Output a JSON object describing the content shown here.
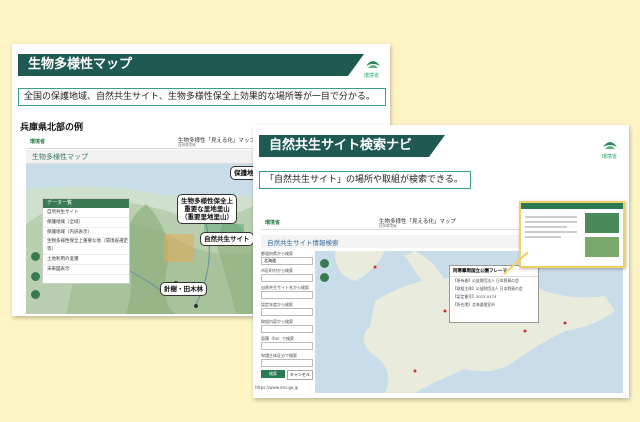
{
  "card1": {
    "title": "生物多様性マップ",
    "logo_text": "環境省",
    "description": "全国の保護地域、自然共生サイト、生物多様性保全上効果的な場所等が一目で分かる。",
    "example_label": "兵庫県北部の例",
    "site_header_title": "生物多様性「見える化」マップ",
    "site_header_sub": "自然環境局",
    "logo_small": "環境省",
    "map_title": "生物多様性マップ",
    "layer_panel_title": "データ一覧",
    "layers": [
      "自然共生サイト",
      "保護地域（全域）",
      "保護地域（内訳表示）",
      "生物多様性保全上重要な地（環境省選定等）",
      "土地利用の変遷",
      "未来図表示"
    ],
    "callouts": {
      "protected": "保護地域",
      "important": "生物多様性保全上\n重要な里地里山\n（重要里地里山）",
      "oecm": "自然共生サイト",
      "forest": "針樹・田木林"
    }
  },
  "card2": {
    "title": "自然共生サイト検索ナビ",
    "logo_text": "環境省",
    "description": "「自然共生サイト」の場所や取組が検索できる。",
    "site_header_title": "生物多様性「見える化」マップ",
    "site_header_sub": "自然環境局",
    "logo_small": "環境省",
    "page_title": "自然共生サイト情報検索",
    "search_labels": [
      "都道府県から検索",
      "市区町村から検索",
      "自然共生サイト名から検索",
      "認定年度から検索",
      "取組内容から検索",
      "面積（ha）で検索",
      "申請主体区分で検索"
    ],
    "search_placeholder": "北海道",
    "popup_title": "阿寒摩周国立公園フレーマ",
    "popup_lines": [
      "【所有者】公益財団法人 日本野鳥の会",
      "【取組主体】公益財団法人 日本野鳥の会",
      "【認定番号】2023-0174",
      "【所在地】北海道根室市"
    ],
    "buttons": [
      "検索",
      "キャンセル"
    ],
    "url": "https://www.env.go.jp"
  }
}
